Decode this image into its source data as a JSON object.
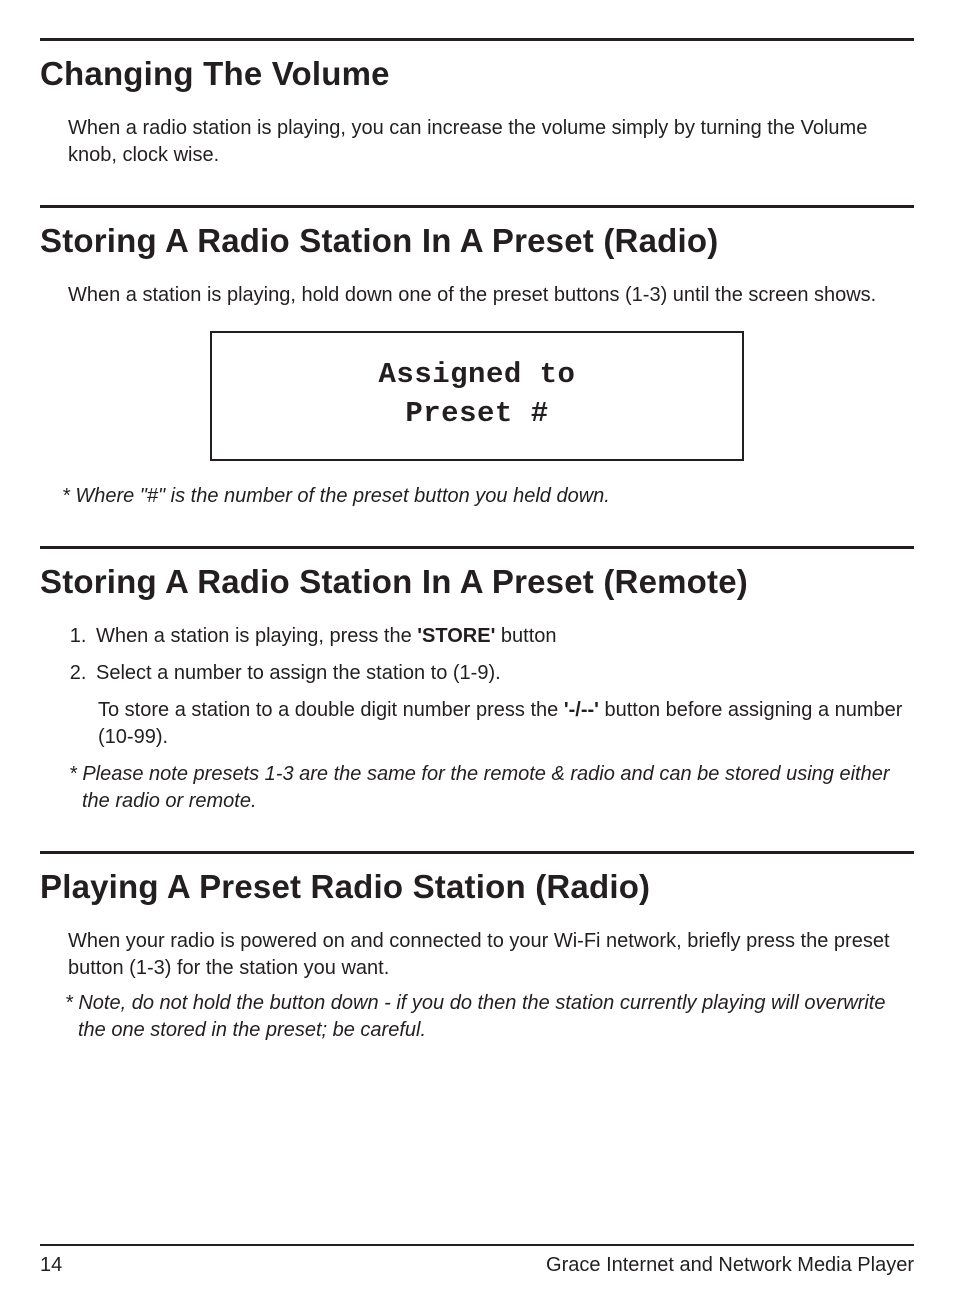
{
  "sections": [
    {
      "heading": "Changing The Volume",
      "body": "When a radio station is playing, you can increase the volume simply by turning the Volume knob, clock wise."
    },
    {
      "heading": "Storing A Radio Station In A Preset (Radio)",
      "body": "When a station is playing, hold down one of the preset buttons (1-3) until the screen shows.",
      "display": {
        "line1": "Assigned to",
        "line2": "Preset #"
      },
      "note": "* Where \"#\" is the number of the preset button you held down."
    },
    {
      "heading": "Storing A Radio Station In A Preset (Remote)",
      "steps": {
        "item1_pre": "When a station is playing, press the ",
        "item1_bold": "'STORE'",
        "item1_post": " button",
        "item2": "Select a number to assign the station to (1-9).",
        "item2_sub_pre": "To store a station to a double digit number press the ",
        "item2_sub_bold": "'-/--'",
        "item2_sub_post": " button before assigning a number (10-99)."
      },
      "note": "* Please note presets 1-3 are the same for the remote & radio and can be stored using either the radio or remote."
    },
    {
      "heading": "Playing A Preset Radio Station (Radio)",
      "body": "When your radio is powered on and connected to your Wi-Fi network, briefly press the preset button (1-3) for the station you want.",
      "note": "* Note, do not hold the button down - if you do then the station currently playing will overwrite the one stored in the preset; be careful."
    }
  ],
  "footer": {
    "page_number": "14",
    "title": "Grace Internet and Network Media Player"
  }
}
